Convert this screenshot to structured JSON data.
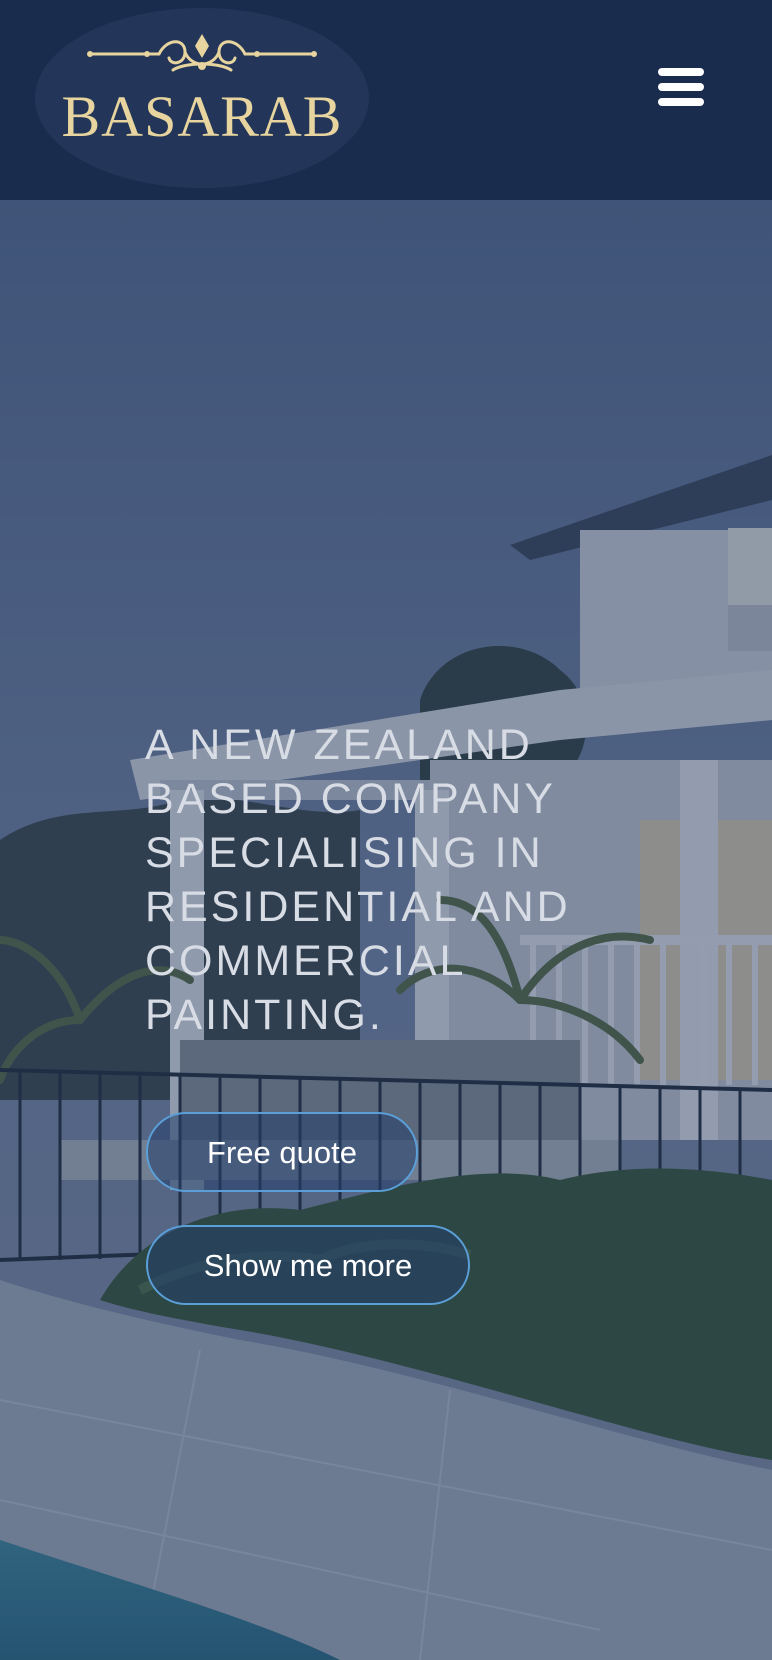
{
  "header": {
    "logo_text": "BASARAB",
    "menu_icon": "hamburger-menu-icon"
  },
  "hero": {
    "headline": "A NEW ZEALAND BASED COMPANY SPECIALISING IN RESIDENTIAL AND COMMERCIAL PAINTING.",
    "primary_button": "Free quote",
    "secondary_button": "Show me more"
  },
  "colors": {
    "header_bg": "#1a2c4e",
    "logo_gold": "#e7d49e",
    "button_border": "#5a9fd8",
    "text_light": "#d8dce4"
  }
}
